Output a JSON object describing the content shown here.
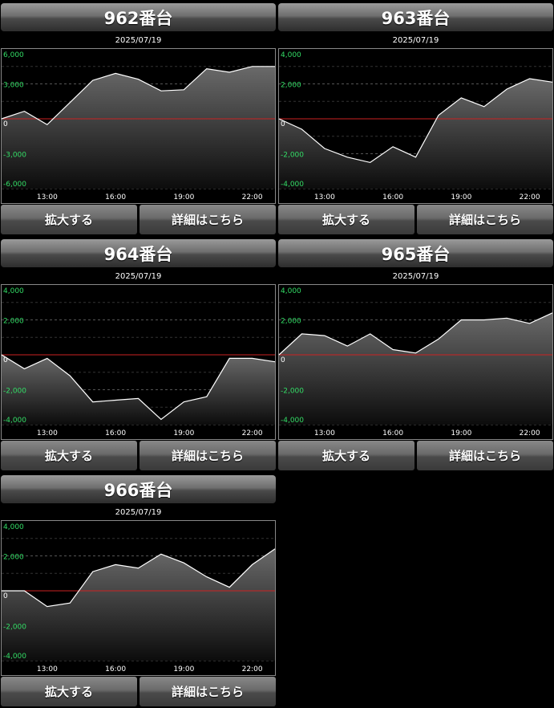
{
  "buttons": {
    "zoom_label": "拡大する",
    "details_label": "詳細はこちら"
  },
  "colors": {
    "grid_line": "#555555",
    "zero_line": "#cc2222",
    "series_line": "#ffffff",
    "tick_green": "#33dd66",
    "tick_zero": "#ffffff"
  },
  "chart_data": [
    {
      "type": "area",
      "title": "962番台",
      "subtitle": "2025/07/19",
      "x_ticks": [
        "13:00",
        "16:00",
        "19:00",
        "22:00"
      ],
      "x": [
        "11:00",
        "12:00",
        "13:00",
        "14:00",
        "15:00",
        "16:00",
        "17:00",
        "18:00",
        "19:00",
        "20:00",
        "21:00",
        "22:00",
        "23:00"
      ],
      "values": [
        0,
        650,
        -500,
        1400,
        3300,
        3900,
        3400,
        2400,
        2500,
        4300,
        4000,
        4500,
        4500
      ],
      "yticks": [
        6000,
        3000,
        0,
        -3000,
        -6000
      ],
      "ytick_labels": [
        "6,000",
        "3,000",
        "0",
        "-3,000",
        "-6,000"
      ],
      "ylim": [
        -6000,
        6000
      ]
    },
    {
      "type": "area",
      "title": "963番台",
      "subtitle": "2025/07/19",
      "x_ticks": [
        "13:00",
        "16:00",
        "19:00",
        "22:00"
      ],
      "x": [
        "11:00",
        "12:00",
        "13:00",
        "14:00",
        "15:00",
        "16:00",
        "17:00",
        "18:00",
        "19:00",
        "20:00",
        "21:00",
        "22:00",
        "23:00"
      ],
      "values": [
        0,
        -600,
        -1700,
        -2200,
        -2500,
        -1600,
        -2200,
        200,
        1200,
        700,
        1700,
        2300,
        2100
      ],
      "yticks": [
        4000,
        2000,
        0,
        -2000,
        -4000
      ],
      "ytick_labels": [
        "4,000",
        "2,000",
        "0",
        "-2,000",
        "-4,000"
      ],
      "ylim": [
        -4000,
        4000
      ]
    },
    {
      "type": "area",
      "title": "964番台",
      "subtitle": "2025/07/19",
      "x_ticks": [
        "13:00",
        "16:00",
        "19:00",
        "22:00"
      ],
      "x": [
        "11:00",
        "12:00",
        "13:00",
        "14:00",
        "15:00",
        "16:00",
        "17:00",
        "18:00",
        "19:00",
        "20:00",
        "21:00",
        "22:00",
        "23:00"
      ],
      "values": [
        0,
        -800,
        -200,
        -1200,
        -2700,
        -2600,
        -2500,
        -3700,
        -2700,
        -2400,
        -200,
        -200,
        -400
      ],
      "yticks": [
        4000,
        2000,
        0,
        -2000,
        -4000
      ],
      "ytick_labels": [
        "4,000",
        "2,000",
        "0",
        "-2,000",
        "-4,000"
      ],
      "ylim": [
        -4000,
        4000
      ]
    },
    {
      "type": "area",
      "title": "965番台",
      "subtitle": "2025/07/19",
      "x_ticks": [
        "13:00",
        "16:00",
        "19:00",
        "22:00"
      ],
      "x": [
        "11:00",
        "12:00",
        "13:00",
        "14:00",
        "15:00",
        "16:00",
        "17:00",
        "18:00",
        "19:00",
        "20:00",
        "21:00",
        "22:00",
        "23:00"
      ],
      "values": [
        0,
        1200,
        1100,
        500,
        1200,
        300,
        100,
        900,
        2000,
        2000,
        2100,
        1800,
        2400
      ],
      "yticks": [
        4000,
        2000,
        0,
        -2000,
        -4000
      ],
      "ytick_labels": [
        "4,000",
        "2,000",
        "0",
        "-2,000",
        "-4,000"
      ],
      "ylim": [
        -4000,
        4000
      ]
    },
    {
      "type": "area",
      "title": "966番台",
      "subtitle": "2025/07/19",
      "x_ticks": [
        "13:00",
        "16:00",
        "19:00",
        "22:00"
      ],
      "x": [
        "11:00",
        "12:00",
        "13:00",
        "14:00",
        "15:00",
        "16:00",
        "17:00",
        "18:00",
        "19:00",
        "20:00",
        "21:00",
        "22:00",
        "23:00"
      ],
      "values": [
        0,
        0,
        -900,
        -700,
        1100,
        1500,
        1300,
        2100,
        1600,
        800,
        200,
        1500,
        2400
      ],
      "yticks": [
        4000,
        2000,
        0,
        -2000,
        -4000
      ],
      "ytick_labels": [
        "4,000",
        "2,000",
        "0",
        "-2,000",
        "-4,000"
      ],
      "ylim": [
        -4000,
        4000
      ]
    }
  ]
}
